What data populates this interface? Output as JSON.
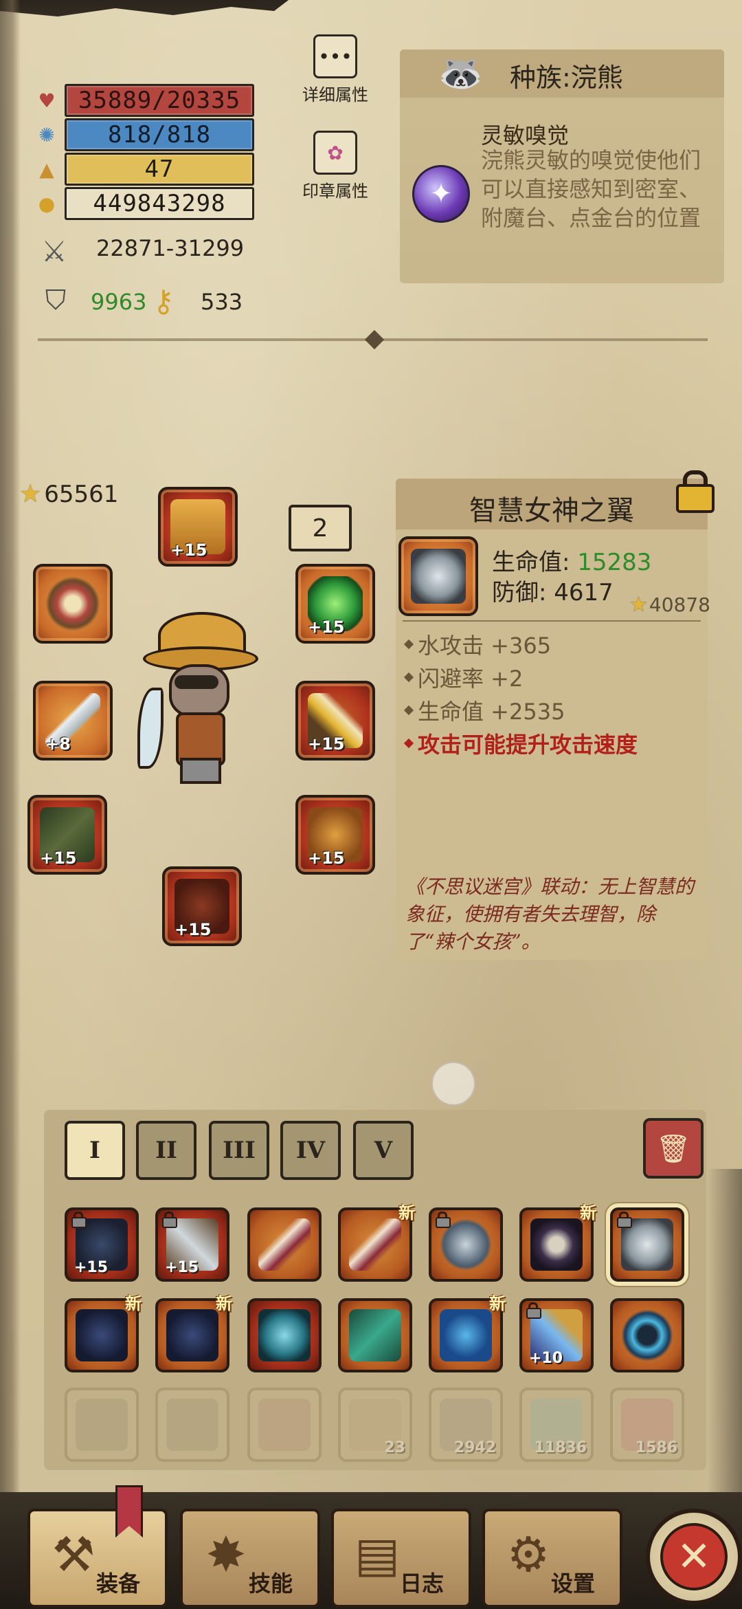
{
  "stats": {
    "hp": "35889/20335",
    "mp": "818/818",
    "level": "47",
    "gold": "449843298",
    "attack": "22871-31299",
    "defense": "9963",
    "keys": "533"
  },
  "side_buttons": {
    "detail_attributes": "详细属性",
    "seal_attributes": "印章属性"
  },
  "race": {
    "title": "种族:浣熊",
    "skill_name": "灵敏嗅觉",
    "skill_desc": "浣熊灵敏的嗅觉使他们可以直接感知到密室、附魔台、点金台的位置"
  },
  "equipment": {
    "total_score": "65561",
    "sockets": "2",
    "slots": [
      {
        "name": "helmet",
        "level": "+15"
      },
      {
        "name": "ring",
        "level": ""
      },
      {
        "name": "amulet",
        "level": "+15"
      },
      {
        "name": "weapon",
        "level": "+8"
      },
      {
        "name": "offhand",
        "level": "+15"
      },
      {
        "name": "gloves",
        "level": "+15"
      },
      {
        "name": "boots",
        "level": "+15"
      },
      {
        "name": "armor",
        "level": "+15"
      }
    ]
  },
  "item_detail": {
    "name": "智慧女神之翼",
    "hp_label": "生命值:",
    "hp_value": "15283",
    "def_label": "防御:",
    "def_value": "4617",
    "score": "40878",
    "bonuses": [
      "水攻击 +365",
      "闪避率 +2",
      "生命值 +2535"
    ],
    "special": "攻击可能提升攻击速度",
    "lore": "《不思议迷宫》联动：无上智慧的象征，使拥有者失去理智，除了“辣个女孩”。"
  },
  "inventory": {
    "tabs": [
      "I",
      "II",
      "III",
      "IV",
      "V"
    ],
    "row1": [
      {
        "level": "+15",
        "new": "",
        "locked": true
      },
      {
        "level": "+15",
        "new": "",
        "locked": true
      },
      {
        "level": "",
        "new": "",
        "locked": false
      },
      {
        "level": "",
        "new": "新",
        "locked": false
      },
      {
        "level": "",
        "new": "",
        "locked": true
      },
      {
        "level": "",
        "new": "新",
        "locked": false
      },
      {
        "level": "",
        "new": "",
        "locked": true
      }
    ],
    "row2": [
      {
        "level": "",
        "new": "新",
        "locked": false
      },
      {
        "level": "",
        "new": "新",
        "locked": false
      },
      {
        "level": "",
        "new": "",
        "locked": false
      },
      {
        "level": "",
        "new": "",
        "locked": false
      },
      {
        "level": "",
        "new": "新",
        "locked": false
      },
      {
        "level": "+10",
        "new": "",
        "locked": true
      },
      {
        "level": "",
        "new": "",
        "locked": false
      }
    ],
    "row3_counts": [
      "",
      "",
      "",
      "23",
      "2942",
      "11836",
      "1586"
    ]
  },
  "nav": {
    "equip": "装备",
    "skills": "技能",
    "log": "日志",
    "settings": "设置"
  },
  "colors": {
    "hp_bar": "#b3473f",
    "mp_bar": "#4c88c2",
    "level_bar": "#e0bf5a",
    "stat_value_green": "#2f8a2a",
    "special_red": "#b2201a"
  }
}
